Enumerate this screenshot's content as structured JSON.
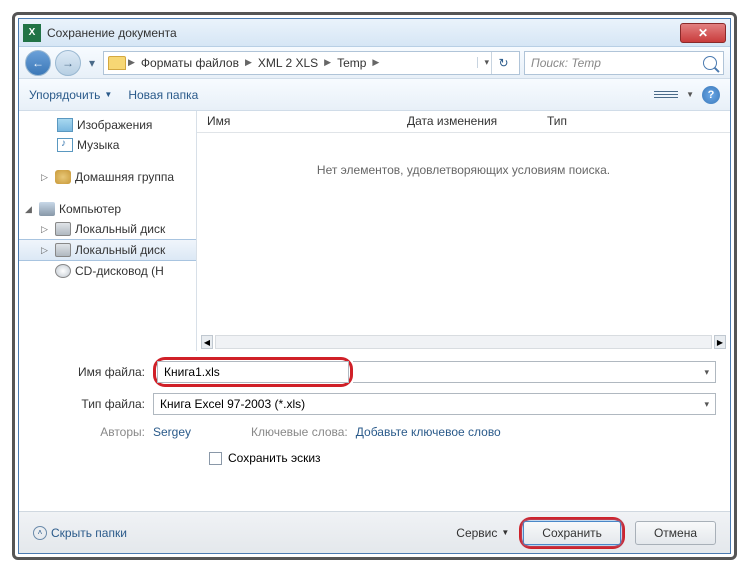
{
  "title": "Сохранение документа",
  "breadcrumb": {
    "p1": "Форматы файлов",
    "p2": "XML 2 XLS",
    "p3": "Temp"
  },
  "search_placeholder": "Поиск: Temp",
  "toolbar": {
    "organize": "Упорядочить",
    "newfolder": "Новая папка"
  },
  "tree": {
    "pictures": "Изображения",
    "music": "Музыка",
    "homegroup": "Домашняя группа",
    "computer": "Компьютер",
    "drive1": "Локальный диск",
    "drive2": "Локальный диск",
    "cd": "CD-дисковод (H"
  },
  "columns": {
    "name": "Имя",
    "date": "Дата изменения",
    "type": "Тип"
  },
  "empty": "Нет элементов, удовлетворяющих условиям поиска.",
  "form": {
    "filename_label": "Имя файла:",
    "filename_value": "Книга1.xls",
    "filetype_label": "Тип файла:",
    "filetype_value": "Книга Excel 97-2003 (*.xls)",
    "authors_label": "Авторы:",
    "authors_value": "Sergey",
    "tags_label": "Ключевые слова:",
    "tags_value": "Добавьте ключевое слово",
    "thumbnail": "Сохранить эскиз"
  },
  "footer": {
    "hide": "Скрыть папки",
    "service": "Сервис",
    "save": "Сохранить",
    "cancel": "Отмена"
  }
}
